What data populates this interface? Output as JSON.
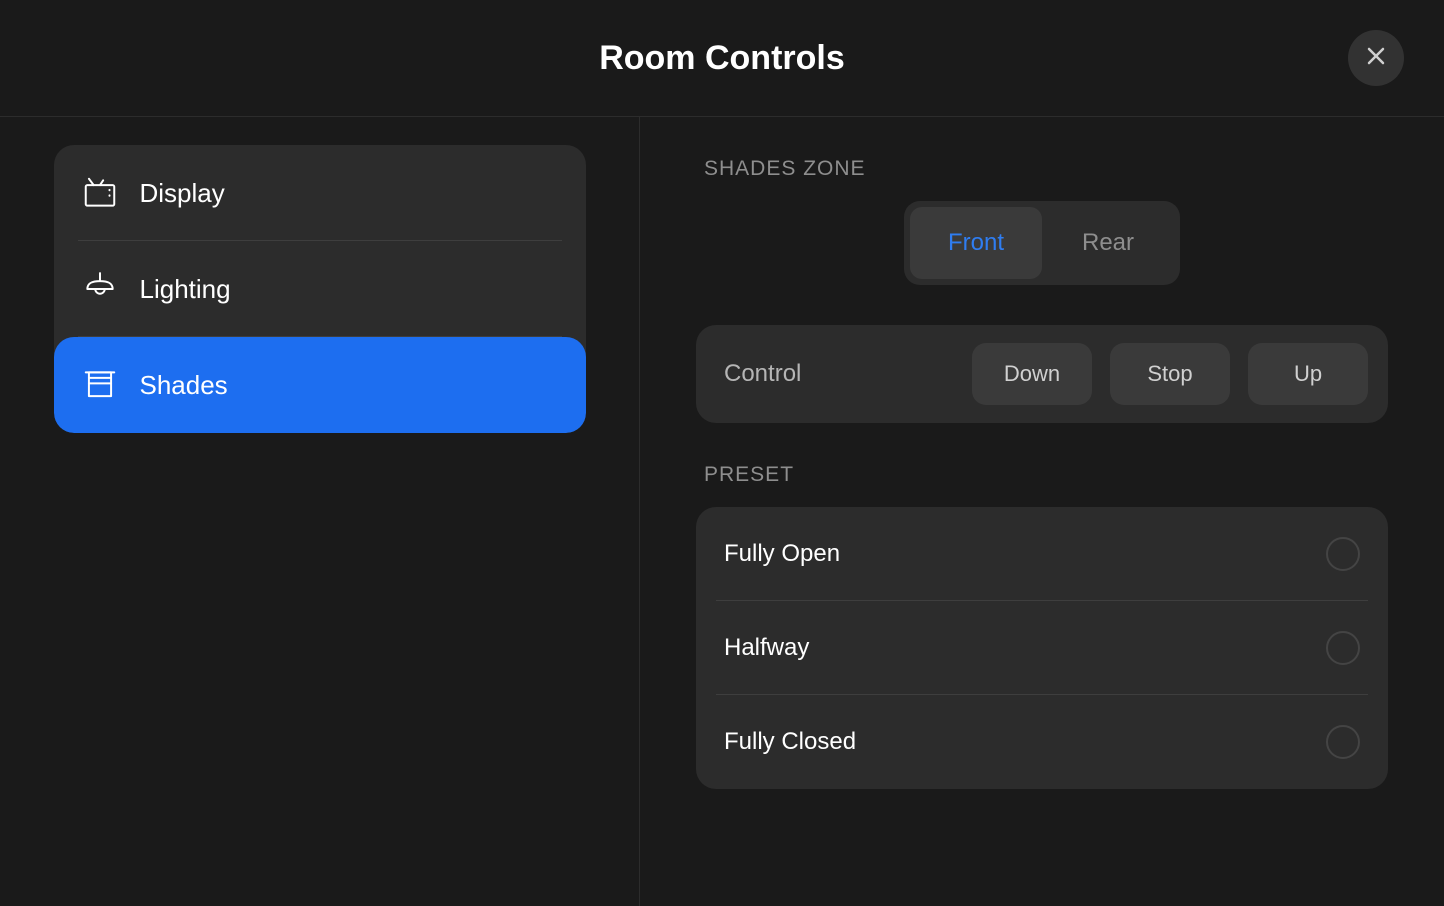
{
  "header": {
    "title": "Room Controls"
  },
  "sidebar": {
    "items": [
      {
        "label": "Display",
        "icon": "tv",
        "selected": false
      },
      {
        "label": "Lighting",
        "icon": "lamp",
        "selected": false
      },
      {
        "label": "Shades",
        "icon": "shades",
        "selected": true
      }
    ]
  },
  "main": {
    "zone_heading": "SHADES ZONE",
    "zones": [
      {
        "label": "Front",
        "active": true
      },
      {
        "label": "Rear",
        "active": false
      }
    ],
    "control": {
      "label": "Control",
      "buttons": [
        "Down",
        "Stop",
        "Up"
      ]
    },
    "preset_heading": "PRESET",
    "presets": [
      {
        "label": "Fully Open",
        "selected": false
      },
      {
        "label": "Halfway",
        "selected": false
      },
      {
        "label": "Fully Closed",
        "selected": false
      }
    ]
  }
}
